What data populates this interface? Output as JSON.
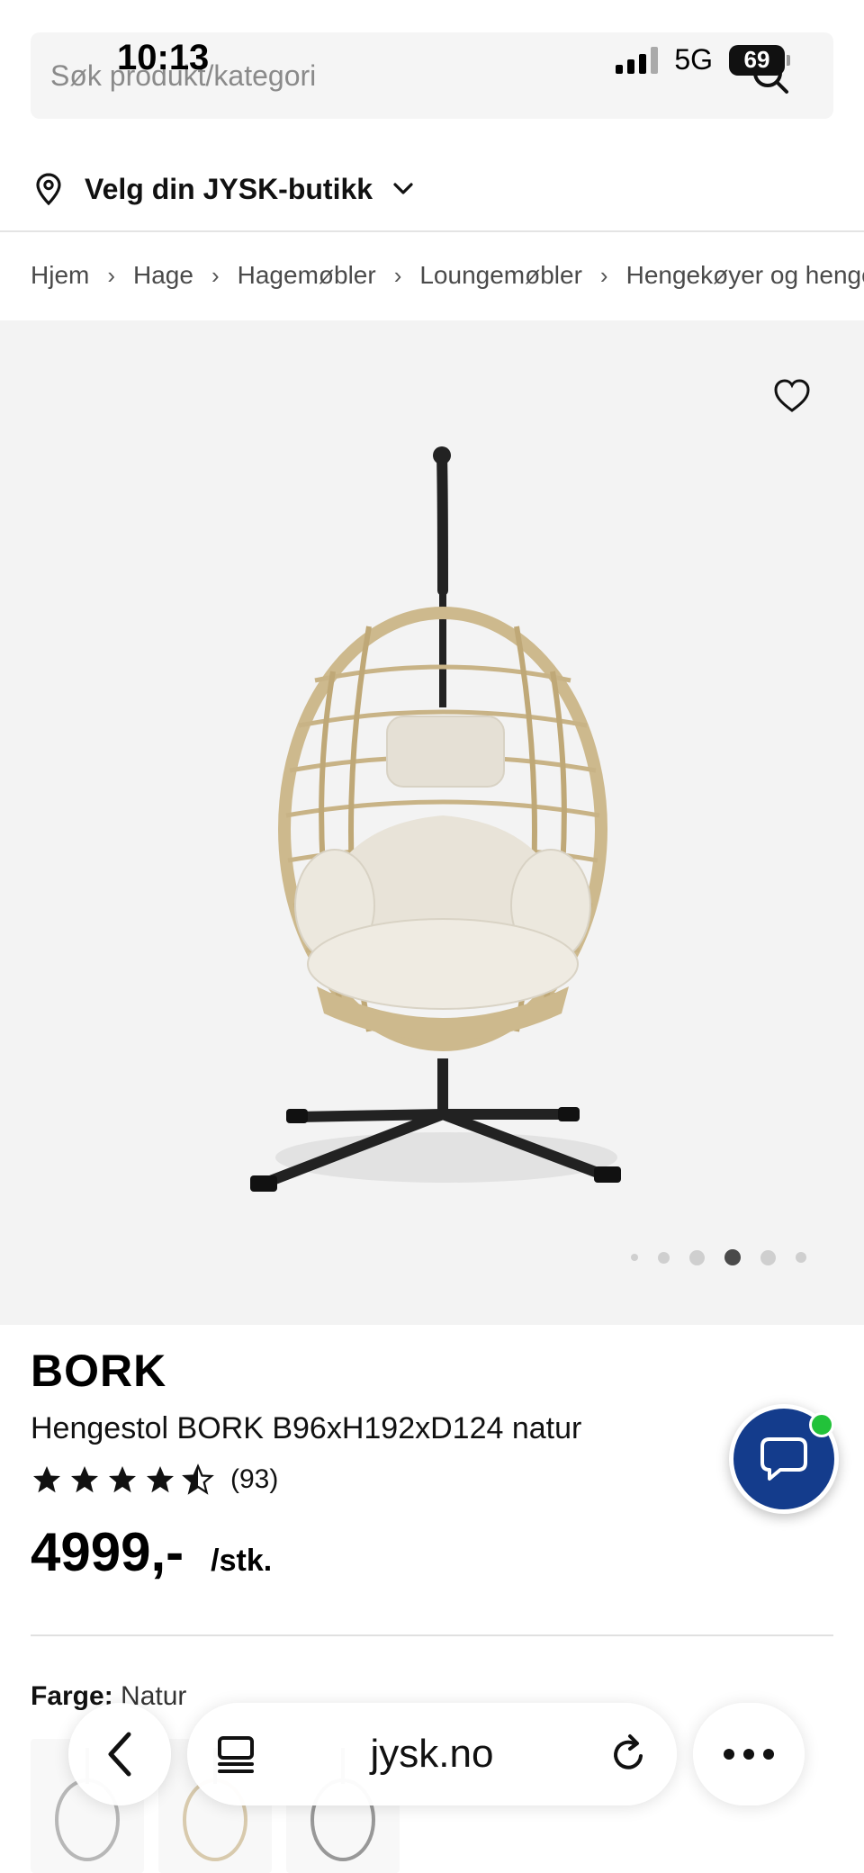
{
  "status_bar": {
    "time": "10:13",
    "network": "5G",
    "battery": "69"
  },
  "search": {
    "placeholder": "Søk produkt/kategori"
  },
  "store": {
    "label": "Velg din JYSK-butikk"
  },
  "breadcrumb": [
    "Hjem",
    "Hage",
    "Hagemøbler",
    "Loungemøbler",
    "Hengekøyer og hengestoler"
  ],
  "gallery": {
    "image_count": 6,
    "active_index": 3
  },
  "product": {
    "brand": "BORK",
    "name": "Hengestol BORK B96xH192xD124 natur",
    "rating": 4.5,
    "review_count": "(93)",
    "price": "4999,-",
    "unit": "/stk.",
    "color_label": "Farge:",
    "color_value": "Natur"
  },
  "browser": {
    "url": "jysk.no"
  },
  "colors": {
    "chat_button": "#143c8c",
    "online_dot": "#22c23a",
    "hero_bg": "#f3f3f3"
  }
}
